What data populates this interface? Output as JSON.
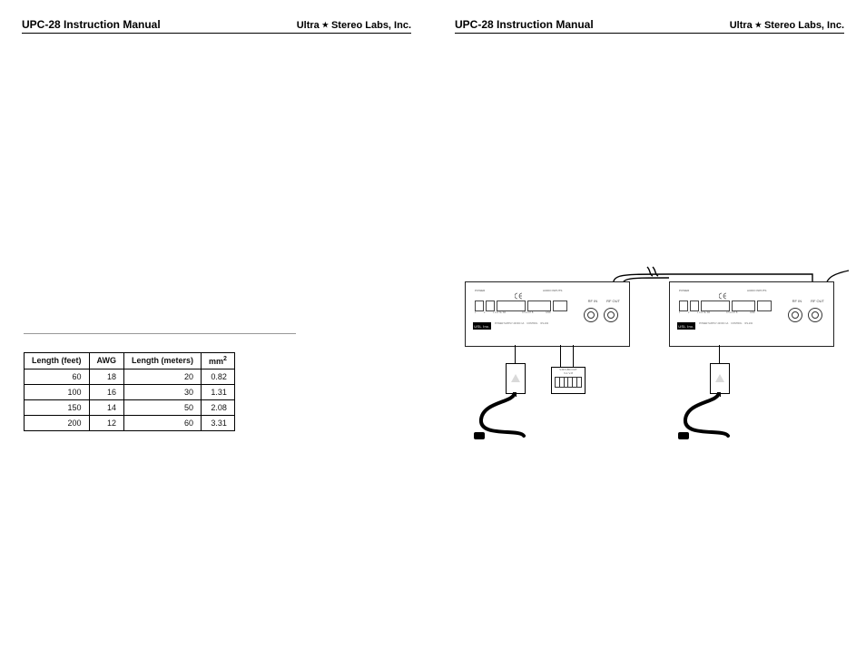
{
  "header": {
    "left": "UPC-28 Instruction Manual",
    "right_a": "Ultra",
    "right_star": "★",
    "right_b": "Stereo Labs, Inc."
  },
  "left_page": {
    "table_caption_prefix": "",
    "table": {
      "cols": [
        "Length (feet)",
        "AWG",
        "Length (meters)",
        "mm²"
      ],
      "rows": [
        [
          "60",
          "18",
          "20",
          "0.82"
        ],
        [
          "100",
          "16",
          "30",
          "1.31"
        ],
        [
          "150",
          "14",
          "50",
          "2.08"
        ],
        [
          "200",
          "12",
          "60",
          "3.31"
        ]
      ]
    }
  },
  "right_page": {
    "unit_badge": "USL Inc.",
    "rf_in": "RF IN",
    "rf_out": "RF OUT",
    "midbox_top": "V-R/V-B4 OUT",
    "midbox_sub": "V-1    V-8"
  }
}
